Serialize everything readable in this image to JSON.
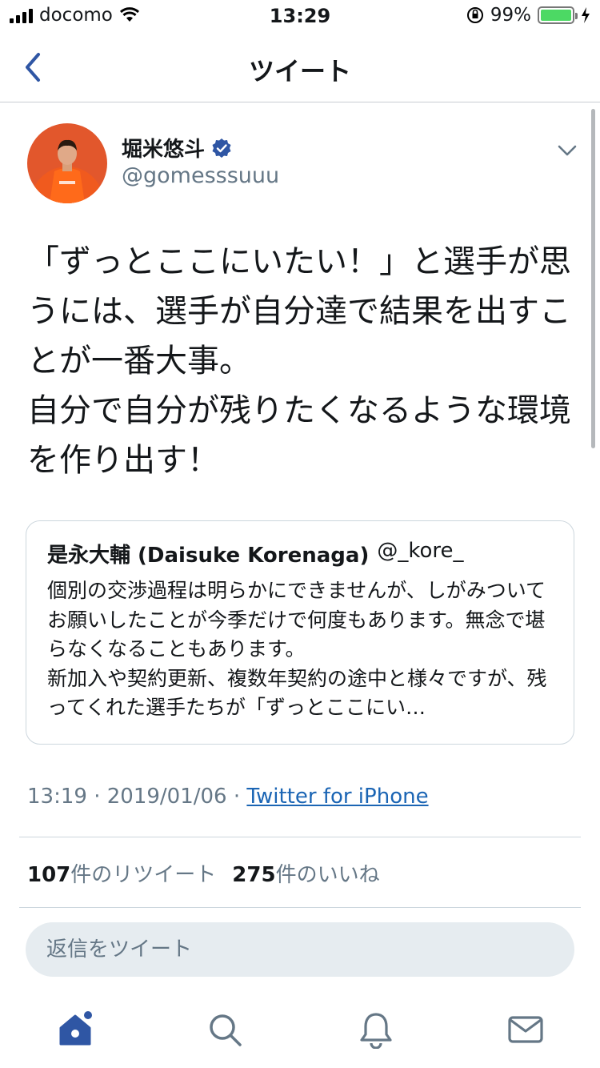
{
  "status_bar": {
    "carrier": "docomo",
    "time": "13:29",
    "battery_percent": "99%",
    "battery_level": 0.99
  },
  "nav": {
    "title": "ツイート"
  },
  "tweet": {
    "author_name": "堀米悠斗",
    "author_handle": "@gomesssuuu",
    "text": "「ずっとここにいたい！」と選手が思うには、選手が自分達で結果を出すことが一番大事。\n自分で自分が残りたくなるような環境を作り出す！",
    "time": "13:19",
    "date": "2019/01/06",
    "source": "Twitter for iPhone",
    "retweets_count": "107",
    "retweets_label": "件のリツイート",
    "likes_count": "275",
    "likes_label": "件のいいね"
  },
  "quote": {
    "name": "是永大輔 (Daisuke Korenaga)",
    "handle": "@_kore_",
    "text": "個別の交渉過程は明らかにできませんが、しがみついてお願いしたことが今季だけで何度もあります。無念で堪らなくなることもあります。\n新加入や契約更新、複数年契約の途中と様々ですが、残ってくれた選手たちが「ずっとここにい…"
  },
  "reply": {
    "placeholder": "返信をツイート"
  },
  "colors": {
    "accent": "#1da1f2",
    "link": "#1b65b4",
    "home_active": "#2f56a4",
    "battery": "#4cd964",
    "secondary_text": "#657786"
  },
  "icons": [
    "back-chevron-icon",
    "verified-badge-icon",
    "caret-down-icon",
    "home-icon",
    "search-icon",
    "notifications-icon",
    "messages-icon"
  ]
}
